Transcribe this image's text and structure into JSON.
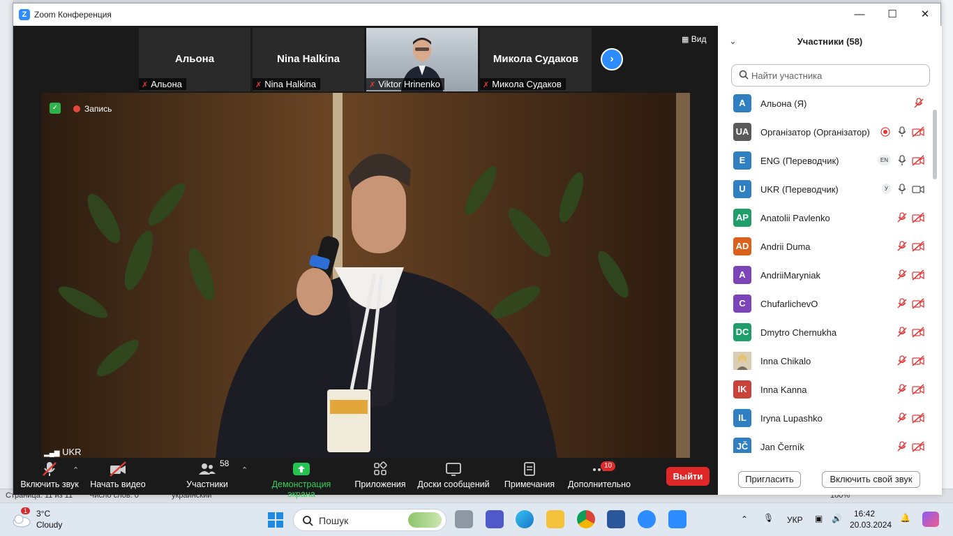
{
  "window": {
    "title": "Zoom Конференция",
    "logo_letter": "Z"
  },
  "view_button": "Вид",
  "thumbnails": [
    {
      "name": "Альона",
      "label": "Альона",
      "video": false
    },
    {
      "name": "Nina Halkina",
      "label": "Nina Halkina",
      "video": false
    },
    {
      "name": "",
      "label": "Viktor Hrinenko",
      "video": true
    },
    {
      "name": "Микола Судаков",
      "label": "Микола Судаков",
      "video": false
    }
  ],
  "recording": {
    "label": "Запись"
  },
  "language_indicator": "UKR",
  "toolbar": {
    "unmute": "Включить звук",
    "start_video": "Начать видео",
    "participants": "Участники",
    "participants_count": "58",
    "share_screen": "Демонстрация экрана",
    "apps": "Приложения",
    "whiteboards": "Доски сообщений",
    "notes": "Примечания",
    "more": "Дополнительно",
    "more_badge": "10",
    "leave": "Выйти"
  },
  "panel": {
    "title": "Участники (58)",
    "search_placeholder": "Найти участника",
    "invite": "Пригласить",
    "unmute_me": "Включить свой звук",
    "participants": [
      {
        "initials": "A",
        "name": "Альона (Я)",
        "color": "#2f7fc1",
        "icons": [
          "mic-muted"
        ]
      },
      {
        "initials": "UA",
        "name": "Організатор (Організатор)",
        "color": "#5a5a5a",
        "icons": [
          "record",
          "mic",
          "video-off"
        ]
      },
      {
        "initials": "E",
        "name": "ENG (Переводчик)",
        "color": "#2f7fc1",
        "badge": "EN",
        "icons": [
          "mic",
          "video-off"
        ]
      },
      {
        "initials": "U",
        "name": "UKR (Переводчик)",
        "color": "#2f7fc1",
        "badge": "У",
        "icons": [
          "mic",
          "video"
        ]
      },
      {
        "initials": "AP",
        "name": "Anatolii Pavlenko",
        "color": "#1f9e6c",
        "icons": [
          "mic-muted",
          "video-off"
        ]
      },
      {
        "initials": "AD",
        "name": "Andrii Duma",
        "color": "#d9611b",
        "icons": [
          "mic-muted",
          "video-off"
        ]
      },
      {
        "initials": "A",
        "name": "AndriiMaryniak",
        "color": "#7b45b8",
        "icons": [
          "mic-muted",
          "video-off"
        ]
      },
      {
        "initials": "C",
        "name": "ChufarlichevO",
        "color": "#7b45b8",
        "icons": [
          "mic-muted",
          "video-off"
        ]
      },
      {
        "initials": "DC",
        "name": "Dmytro Chernukha",
        "color": "#1f9e6c",
        "icons": [
          "mic-muted",
          "video-off"
        ]
      },
      {
        "initials": "",
        "name": "Inna Chikalo",
        "color": "#d7c6a6",
        "photo": true,
        "icons": [
          "mic-muted",
          "video-off"
        ]
      },
      {
        "initials": "IK",
        "name": "Inna Kanna",
        "color": "#c9433b",
        "icons": [
          "mic-muted",
          "video-off"
        ]
      },
      {
        "initials": "IL",
        "name": "Iryna Lupashko",
        "color": "#2f7fc1",
        "icons": [
          "mic-muted",
          "video-off"
        ]
      },
      {
        "initials": "JČ",
        "name": "Jan Černík",
        "color": "#2f7fc1",
        "icons": [
          "mic-muted",
          "video-off"
        ]
      }
    ]
  },
  "background_app": {
    "status_page": "Страница: 11 из 11",
    "status_words": "Число слов: 0",
    "status_lang": "украинский",
    "zoom_level": "100%"
  },
  "taskbar": {
    "weather_temp": "3°C",
    "weather_desc": "Cloudy",
    "weather_badge": "1",
    "search_placeholder": "Пошук",
    "lang": "УКР",
    "time": "16:42",
    "date": "20.03.2024"
  }
}
